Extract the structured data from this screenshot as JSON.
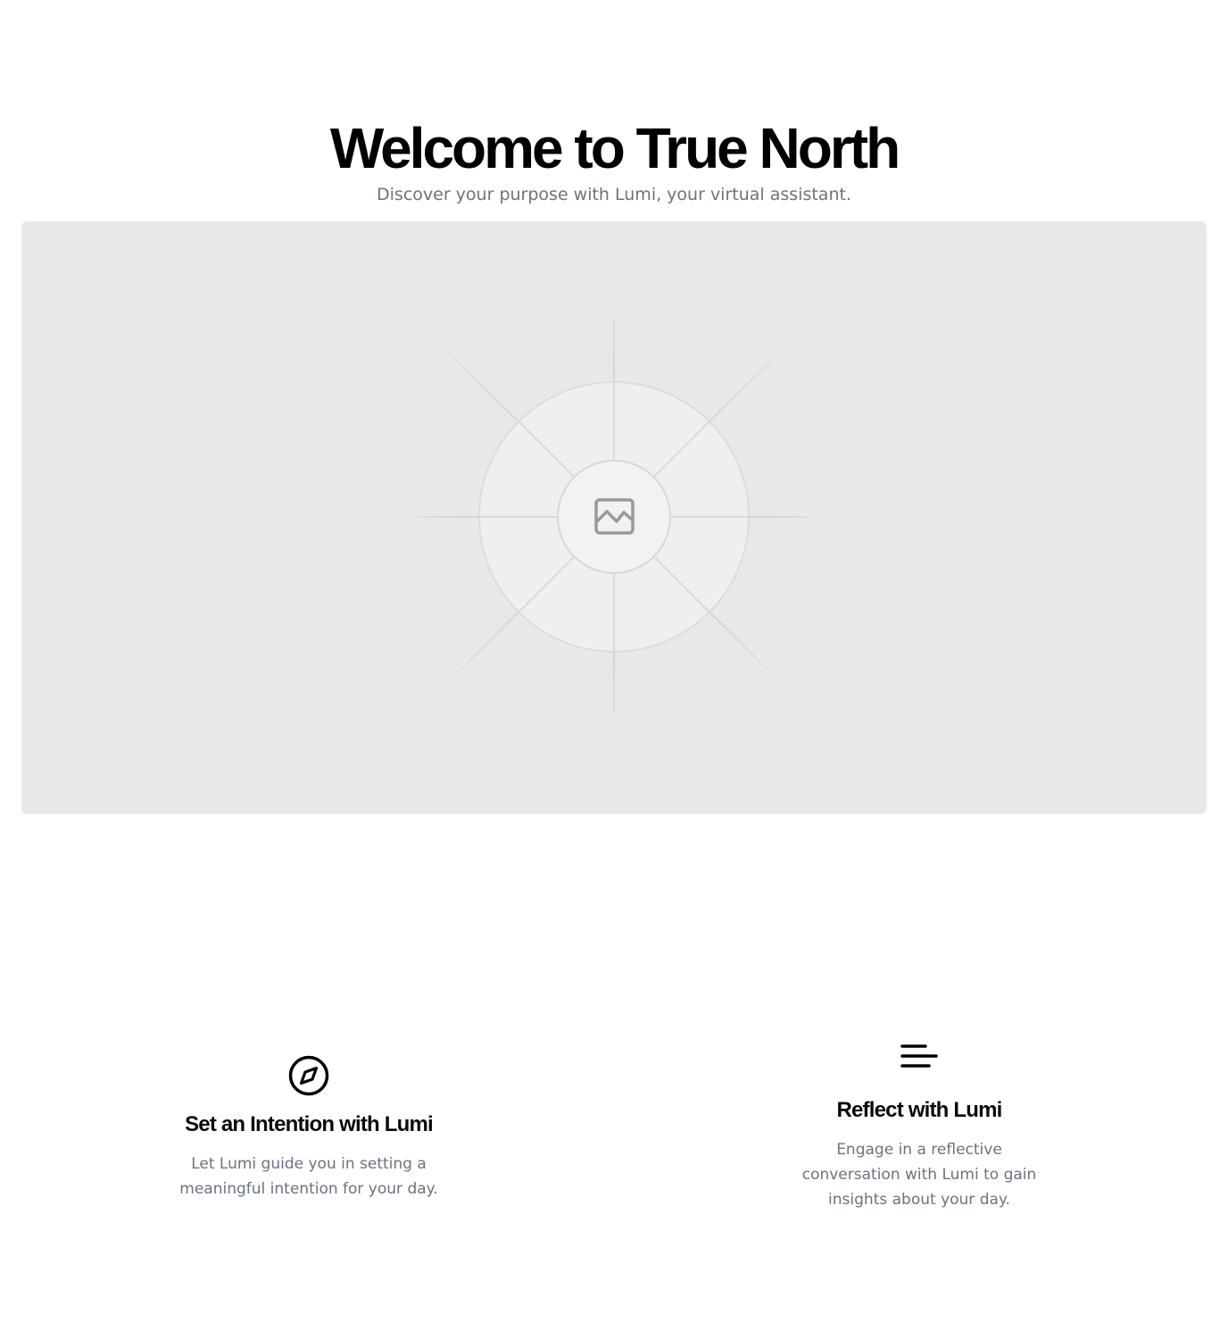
{
  "hero": {
    "title": "Welcome to True North",
    "subtitle": "Discover your purpose with Lumi, your virtual assistant.",
    "image_icon": "image-placeholder-icon"
  },
  "features": [
    {
      "icon": "compass-icon",
      "title": "Set an Intention with Lumi",
      "description": "Let Lumi guide you in setting a meaningful intention for your day."
    },
    {
      "icon": "menu-lines-icon",
      "title": "Reflect with Lumi",
      "description": "Engage in a reflective conversation with Lumi to gain insights about your day."
    }
  ],
  "colors": {
    "text": "#0a0a0a",
    "muted_text": "#6b7280",
    "image_placeholder_bg": "#e8e8e8"
  }
}
